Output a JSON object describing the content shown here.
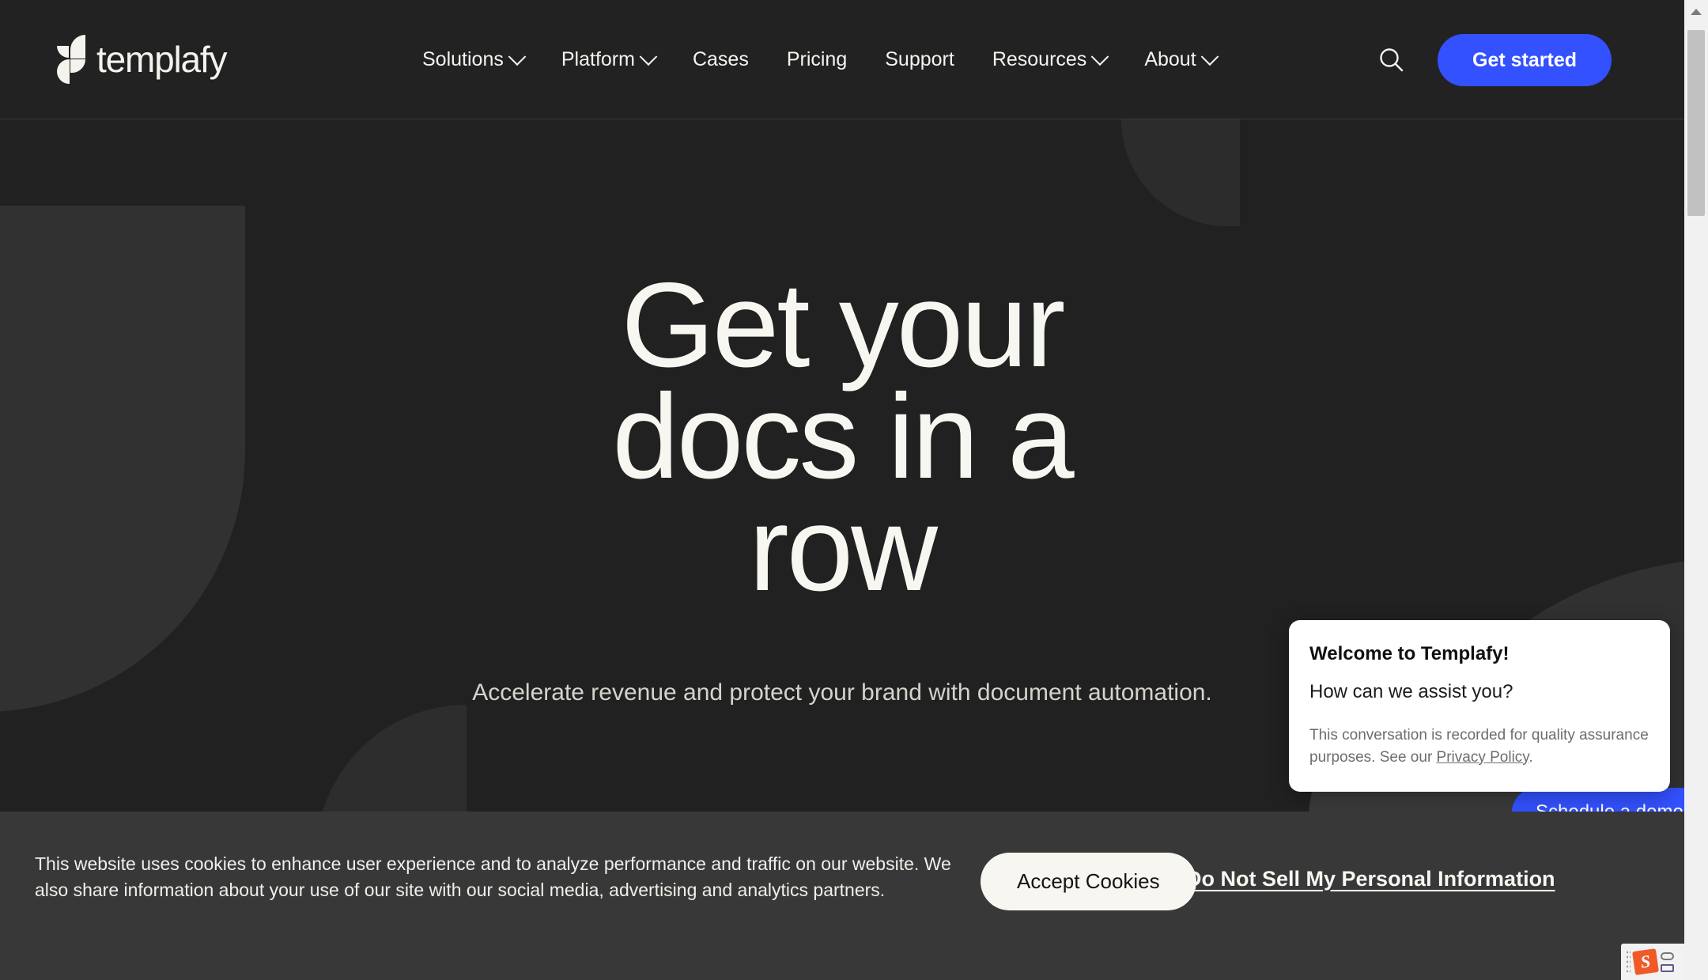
{
  "brand": {
    "name": "templafy",
    "accent_blue": "#3351ff",
    "cream": "#f7f6f1",
    "header_bg": "#222222",
    "hero_bg": "#212121",
    "cookie_bg": "#383838"
  },
  "header": {
    "logo_text": "templafy",
    "nav": [
      {
        "label": "Solutions",
        "has_dropdown": true
      },
      {
        "label": "Platform",
        "has_dropdown": true
      },
      {
        "label": "Cases",
        "has_dropdown": false
      },
      {
        "label": "Pricing",
        "has_dropdown": false
      },
      {
        "label": "Support",
        "has_dropdown": false
      },
      {
        "label": "Resources",
        "has_dropdown": true
      },
      {
        "label": "About",
        "has_dropdown": true
      }
    ],
    "search_icon": "search-icon",
    "cta_label": "Get started"
  },
  "hero": {
    "title_line1": "Get your",
    "title_line2": "docs in a",
    "title_line3": "row",
    "subtitle": "Accelerate revenue and protect your brand with document automation."
  },
  "chat": {
    "title": "Welcome to Templafy!",
    "question": "How can we assist you?",
    "disclaimer_before": "This conversation is recorded for quality assurance purposes. See our ",
    "privacy_link": "Privacy Policy",
    "disclaimer_after": ".",
    "schedule_label": "Schedule a demo"
  },
  "cookies": {
    "text": "This website uses cookies to enhance user experience and to analyze performance and traffic on our website. We also share information about your use of our site with our social media, advertising and analytics partners.",
    "accept_label": "Accept Cookies",
    "do_not_sell_label": "Do Not Sell My Personal Information"
  },
  "extension": {
    "logo_letter": "S"
  }
}
